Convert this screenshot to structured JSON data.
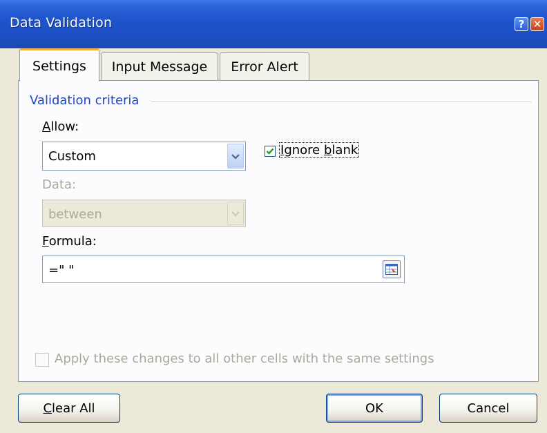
{
  "window": {
    "title": "Data Validation",
    "help_glyph": "?",
    "close_glyph": "✕"
  },
  "tabs": [
    {
      "label": "Settings",
      "active": true
    },
    {
      "label": "Input Message",
      "active": false
    },
    {
      "label": "Error Alert",
      "active": false
    }
  ],
  "settings": {
    "group_title": "Validation criteria",
    "allow": {
      "label_key": "A",
      "label_rest": "llow:",
      "value": "Custom"
    },
    "ignore_blank": {
      "label_pre": "I",
      "label_mid": "gnore ",
      "label_key": "b",
      "label_post": "lank",
      "checked": true
    },
    "data": {
      "label": "Data:",
      "value": "between",
      "disabled": true
    },
    "formula": {
      "label_key": "F",
      "label_rest": "ormula:",
      "value": "=\" \""
    },
    "apply_all": {
      "label": "Apply these changes to all other cells with the same settings",
      "checked": false,
      "disabled": true
    }
  },
  "buttons": {
    "clear_all": {
      "label_key": "C",
      "label_rest": "lear All"
    },
    "ok": {
      "label": "OK"
    },
    "cancel": {
      "label": "Cancel"
    }
  },
  "colors": {
    "titlebar": "#1d4fc4",
    "accent_tab": "#f0b238",
    "group_title": "#1f45c8",
    "checkmark": "#21a121"
  },
  "icons": [
    "help-icon",
    "close-icon",
    "dropdown-arrow-icon",
    "checkmark-icon",
    "collapse-dialog-icon"
  ]
}
